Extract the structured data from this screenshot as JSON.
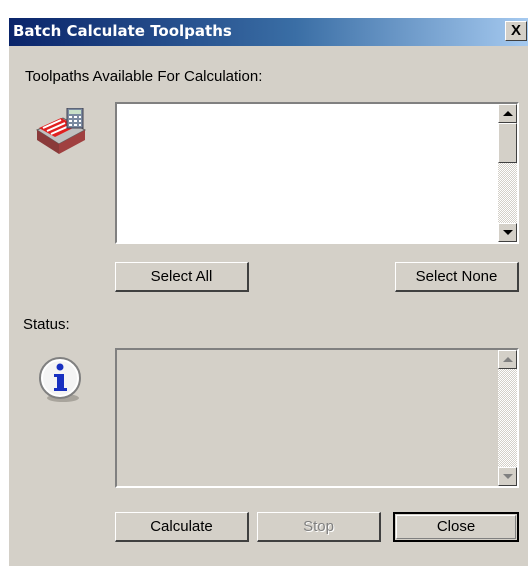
{
  "dialog": {
    "title": "Batch Calculate Toolpaths",
    "close_glyph": "X"
  },
  "toolpaths": {
    "label": "Toolpaths Available For Calculation:",
    "icon": "toolpath-calculator-icon",
    "items": []
  },
  "selection": {
    "select_all": "Select All",
    "select_none": "Select None"
  },
  "status": {
    "label": "Status:",
    "icon": "info-icon",
    "text": ""
  },
  "actions": {
    "calculate": "Calculate",
    "stop": "Stop",
    "close": "Close"
  },
  "colors": {
    "face": "#d4d0c8",
    "title_start": "#0a246a",
    "title_end": "#a6caf0"
  }
}
